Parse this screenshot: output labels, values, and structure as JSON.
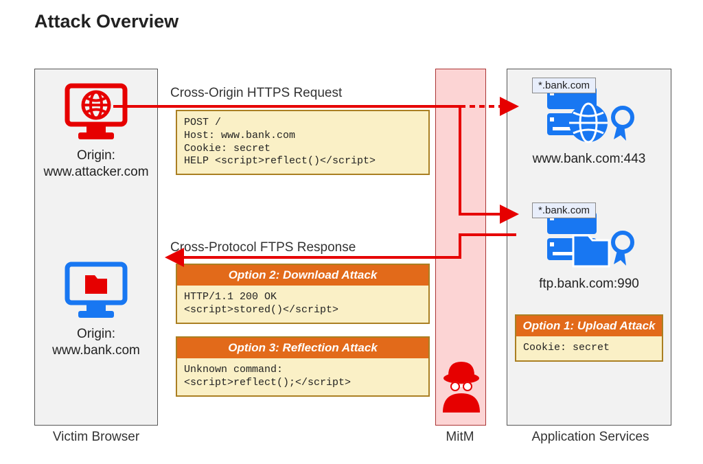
{
  "title": "Attack Overview",
  "victim": {
    "caption": "Victim Browser",
    "browser1_origin_label": "Origin:",
    "browser1_origin": "www.attacker.com",
    "browser2_origin_label": "Origin:",
    "browser2_origin": "www.bank.com"
  },
  "mitm": {
    "caption": "MitM"
  },
  "services": {
    "caption": "Application Services",
    "server1_cert": "*.bank.com",
    "server1_label": "www.bank.com:443",
    "server2_cert": "*.bank.com",
    "server2_label": "ftp.bank.com:990"
  },
  "flows": {
    "request_label": "Cross-Origin HTTPS Request",
    "request_body": "POST /\nHost: www.bank.com\nCookie: secret\nHELP <script>reflect()</script>",
    "response_label": "Cross-Protocol FTPS Response"
  },
  "option1": {
    "header": "Option 1: Upload Attack",
    "body": "Cookie: secret"
  },
  "option2": {
    "header": "Option 2: Download Attack",
    "body": "HTTP/1.1 200 OK\n<script>stored()</script>"
  },
  "option3": {
    "header": "Option 3: Reflection Attack",
    "body": "Unknown command:\n<script>reflect();</script>"
  }
}
